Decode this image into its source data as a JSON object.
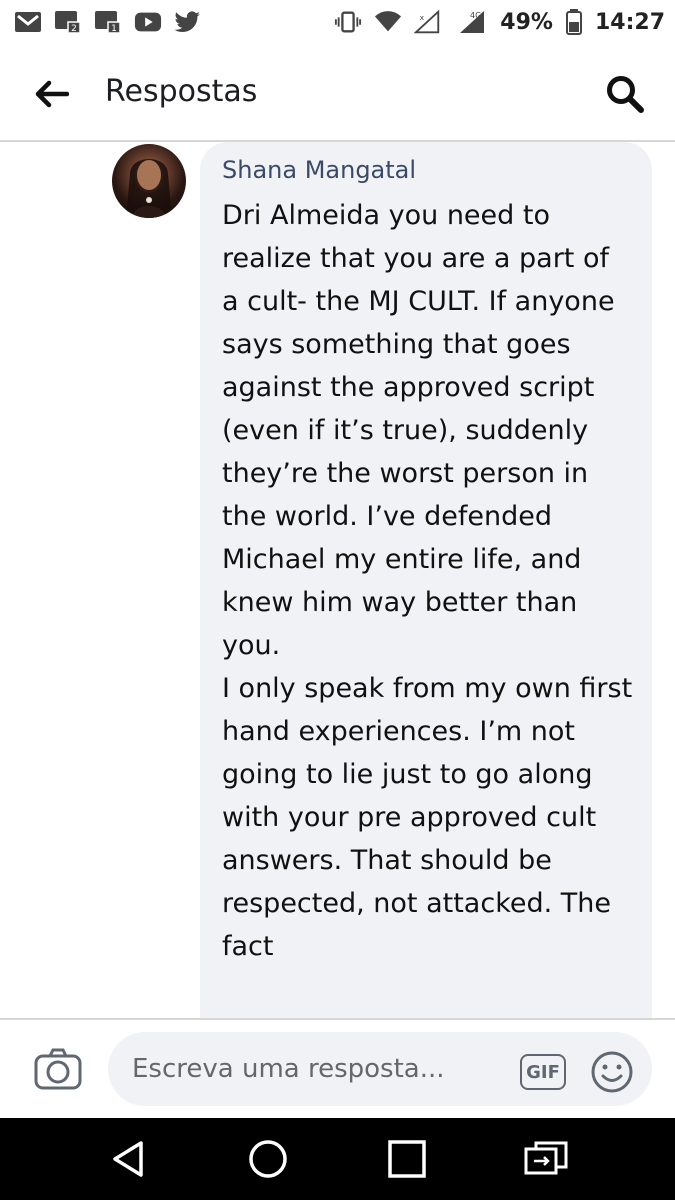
{
  "status_bar": {
    "battery": "49%",
    "time": "14:27",
    "network": "4G",
    "icons_left": [
      "gmail-icon",
      "sim2-notification-icon",
      "sim1-notification-icon",
      "youtube-icon",
      "twitter-icon"
    ],
    "icons_right": [
      "vibrate-icon",
      "wifi-icon",
      "signal-icon",
      "battery-icon"
    ]
  },
  "header": {
    "title": "Respostas",
    "back_icon": "arrow-left-icon",
    "search_icon": "search-icon"
  },
  "comment": {
    "author": "Shana Mangatal",
    "mention": "Dri Almeida",
    "text": " you need to realize that you are a part of a cult- the MJ CULT. If anyone says something that goes against the approved script (even if it’s true), suddenly they’re the worst person in the world. I’ve defended Michael my entire life, and knew him way better than you.\nI only speak from my own first hand experiences. I’m not going to lie just to go along with your pre approved cult answers. That should be respected, not attacked. The fact"
  },
  "composer": {
    "placeholder": "Escreva uma resposta...",
    "gif_label": "GIF",
    "camera_icon": "camera-icon",
    "emoji_icon": "smiley-icon"
  },
  "nav": {
    "back": "nav-back-icon",
    "home": "nav-home-icon",
    "recents": "nav-recents-icon",
    "extra": "screen-switch-icon"
  }
}
